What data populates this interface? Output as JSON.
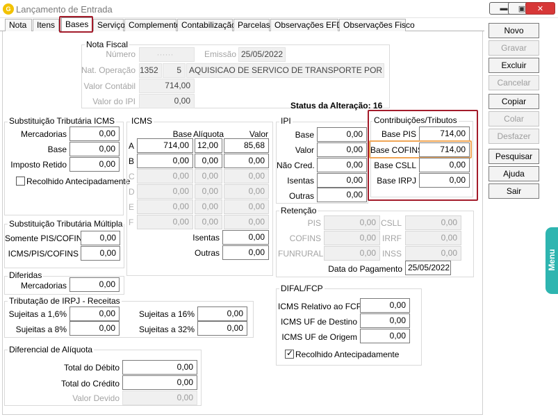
{
  "window": {
    "title": "Lançamento de Entrada",
    "controls": [
      "minimize-icon",
      "maximize-icon",
      "close-icon"
    ]
  },
  "tabs": [
    "Nota",
    "Itens",
    "Bases",
    "Serviço",
    "Complemento",
    "Contabilização",
    "Parcelas",
    "Observações EFD",
    "Observações Fisco"
  ],
  "active_tab": "Bases",
  "nota_fiscal": {
    "title": "Nota Fiscal",
    "numero_label": "Número",
    "numero_value": "······",
    "emissao_label": "Emissão",
    "emissao_value": "25/05/2022",
    "nat_op_label": "Nat. Operação",
    "nat_op_code": "1352",
    "nat_op_seq": "5",
    "nat_op_desc": "AQUISICAO DE SERVICO DE TRANSPORTE POR ESTABELE",
    "valor_contabil_label": "Valor Contábil",
    "valor_contabil_value": "714,00",
    "valor_ipi_label": "Valor do IPI",
    "valor_ipi_value": "0,00"
  },
  "status_alteracao": "Status da Alteração: 16",
  "st_icms": {
    "title": "Substituição Tributária ICMS",
    "mercadorias_label": "Mercadorias",
    "mercadorias_value": "0,00",
    "base_label": "Base",
    "base_value": "0,00",
    "imposto_label": "Imposto Retido",
    "imposto_value": "0,00",
    "recolhido_label": "Recolhido Antecipadamente"
  },
  "icms": {
    "title": "ICMS",
    "col_base": "Base",
    "col_aliquota": "Alíquota",
    "col_valor": "Valor",
    "rows": [
      {
        "letter": "A",
        "base": "714,00",
        "aliquota": "12,00",
        "valor": "85,68"
      },
      {
        "letter": "B",
        "base": "0,00",
        "aliquota": "0,00",
        "valor": "0,00"
      },
      {
        "letter": "C",
        "base": "0,00",
        "aliquota": "0,00",
        "valor": "0,00"
      },
      {
        "letter": "D",
        "base": "0,00",
        "aliquota": "0,00",
        "valor": "0,00"
      },
      {
        "letter": "E",
        "base": "0,00",
        "aliquota": "0,00",
        "valor": "0,00"
      },
      {
        "letter": "F",
        "base": "0,00",
        "aliquota": "0,00",
        "valor": "0,00"
      }
    ],
    "isentas_label": "Isentas",
    "isentas_value": "0,00",
    "outras_label": "Outras",
    "outras_value": "0,00"
  },
  "ipi": {
    "title": "IPI",
    "base_label": "Base",
    "base_value": "0,00",
    "valor_label": "Valor",
    "valor_value": "0,00",
    "nao_cred_label": "Não Cred.",
    "nao_cred_value": "0,00",
    "isentas_label": "Isentas",
    "isentas_value": "0,00",
    "outras_label": "Outras",
    "outras_value": "0,00"
  },
  "contribuicoes": {
    "title": "Contribuições/Tributos",
    "base_pis_label": "Base PIS",
    "base_pis_value": "714,00",
    "base_cofins_label": "Base COFINS",
    "base_cofins_value": "714,00",
    "base_csll_label": "Base CSLL",
    "base_csll_value": "0,00",
    "base_irpj_label": "Base IRPJ",
    "base_irpj_value": "0,00"
  },
  "retencao": {
    "title": "Retenção",
    "pis_label": "PIS",
    "pis_value": "0,00",
    "csll_label": "CSLL",
    "csll_value": "0,00",
    "cofins_label": "COFINS",
    "cofins_value": "0,00",
    "irrf_label": "IRRF",
    "irrf_value": "0,00",
    "funrural_label": "FUNRURAL",
    "funrural_value": "0,00",
    "inss_label": "INSS",
    "inss_value": "0,00",
    "data_pag_label": "Data do Pagamento",
    "data_pag_value": "25/05/2022"
  },
  "st_multipla": {
    "title": "Substituição Tributária Múltipla",
    "somente_label": "Somente PIS/COFINS",
    "somente_value": "0,00",
    "icms_pis_label": "ICMS/PIS/COFINS",
    "icms_pis_value": "0,00"
  },
  "diferidas": {
    "title": "Diferidas",
    "mercadorias_label": "Mercadorias",
    "mercadorias_value": "0,00"
  },
  "irpj": {
    "title": "Tributação de IRPJ - Receitas",
    "s16_label": "Sujeitas a 1,6%",
    "s16_value": "0,00",
    "s8_label": "Sujeitas a 8%",
    "s8_value": "0,00",
    "s160_label": "Sujeitas a 16%",
    "s160_value": "0,00",
    "s32_label": "Sujeitas a 32%",
    "s32_value": "0,00"
  },
  "difal": {
    "title": "DIFAL/FCP",
    "icms_rel_label": "ICMS Relativo ao FCP",
    "icms_rel_value": "0,00",
    "uf_dest_label": "ICMS UF de Destino",
    "uf_dest_value": "0,00",
    "uf_orig_label": "ICMS UF de Origem",
    "uf_orig_value": "0,00",
    "recolhido_label": "Recolhido Antecipadamente"
  },
  "dif_aliquota": {
    "title": "Diferencial de Alíquota",
    "debito_label": "Total do Débito",
    "debito_value": "0,00",
    "credito_label": "Total do Crédito",
    "credito_value": "0,00",
    "devido_label": "Valor Devido",
    "devido_value": "0,00"
  },
  "side_buttons": [
    "Novo",
    "Gravar",
    "Excluir",
    "Cancelar",
    "Copiar",
    "Colar",
    "Desfazer",
    "Pesquisar",
    "Ajuda",
    "Sair"
  ],
  "menu_label": "Menu"
}
